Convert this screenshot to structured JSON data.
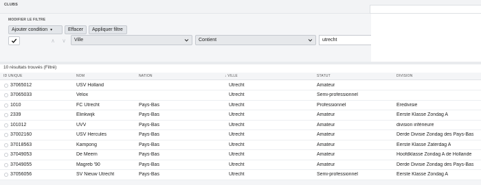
{
  "header": {
    "title": "CLUBS"
  },
  "filter": {
    "label": "MODIFIER LE FILTRE",
    "add_condition": "Ajouter condition",
    "clear": "Effacer",
    "apply": "Appliquer filtre",
    "condition": {
      "checked": true,
      "field": "Ville",
      "operator": "Contient",
      "value": "utrecht"
    }
  },
  "results": {
    "count_text": "10 résultats trouvés (Filtré)"
  },
  "table": {
    "columns": {
      "id": "ID UNIQUE",
      "name": "NOM",
      "nation": "NATION",
      "city": "↓ VILLE",
      "status": "STATUT",
      "division": "DIVISION"
    },
    "rows": [
      {
        "id": "37065012",
        "name": "USV Holland",
        "nation": "",
        "city": "Utrecht",
        "status": "Amateur",
        "division": ""
      },
      {
        "id": "37065033",
        "name": "Velox",
        "nation": "",
        "city": "Utrecht",
        "status": "Semi-professionnel",
        "division": ""
      },
      {
        "id": "1010",
        "name": "FC Utrecht",
        "nation": "Pays-Bas",
        "city": "Utrecht",
        "status": "Professionnel",
        "division": "Eredivisie"
      },
      {
        "id": "2339",
        "name": "Elinkwijk",
        "nation": "Pays-Bas",
        "city": "Utrecht",
        "status": "Amateur",
        "division": "Eerste Klasse Zondag A"
      },
      {
        "id": "101012",
        "name": "UVV",
        "nation": "Pays-Bas",
        "city": "Utrecht",
        "status": "Amateur",
        "division": "division inférieure"
      },
      {
        "id": "37002160",
        "name": "USV Hercules",
        "nation": "Pays-Bas",
        "city": "Utrecht",
        "status": "Amateur",
        "division": "Derde Divisie Zondag des Pays-Bas"
      },
      {
        "id": "37018563",
        "name": "Kampong",
        "nation": "Pays-Bas",
        "city": "Utrecht",
        "status": "Amateur",
        "division": "Eerste Klasse Zaterdag A"
      },
      {
        "id": "37049053",
        "name": "De Meern",
        "nation": "Pays-Bas",
        "city": "Utrecht",
        "status": "Amateur",
        "division": "Hoofdklasse Zondag A de Hollande"
      },
      {
        "id": "37049055",
        "name": "Magreb '90",
        "nation": "Pays-Bas",
        "city": "Utrecht",
        "status": "Amateur",
        "division": "Derde Divisie Zondag des Pays-Bas"
      },
      {
        "id": "37056056",
        "name": "SV Nieuw Utrecht",
        "nation": "Pays-Bas",
        "city": "Utrecht",
        "status": "Semi-professionnel",
        "division": "Eerste Klasse Zondag A"
      }
    ]
  }
}
